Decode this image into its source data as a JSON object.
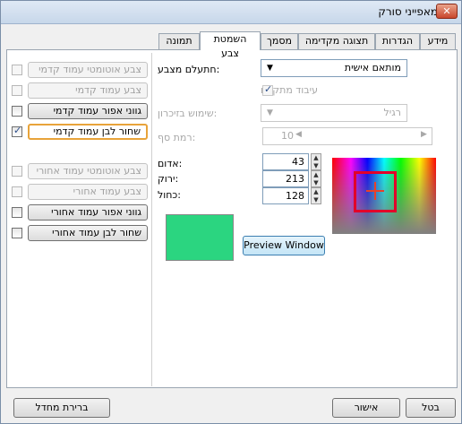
{
  "window": {
    "title": "מאפייני סורק",
    "close_label": "✕"
  },
  "tabs": [
    "מידע",
    "הגדרות",
    "תצוגה מקדימה",
    "מסמך",
    "השמטת צבע",
    "תמונה"
  ],
  "active_tab": "השמטת צבע",
  "options": [
    {
      "label": "צבע אוטומטי עמוד קדמי",
      "enabled": false,
      "checked": false,
      "selected": false
    },
    {
      "label": "צבע עמוד קדמי",
      "enabled": false,
      "checked": false,
      "selected": false
    },
    {
      "label": "גווני אפור עמוד קדמי",
      "enabled": true,
      "checked": false,
      "selected": false
    },
    {
      "label": "שחור לבן עמוד קדמי",
      "enabled": true,
      "checked": true,
      "selected": true
    },
    {
      "label": "צבע אוטומטי עמוד אחורי",
      "enabled": false,
      "checked": false,
      "selected": false
    },
    {
      "label": "צבע עמוד אחורי",
      "enabled": false,
      "checked": false,
      "selected": false
    },
    {
      "label": "גווני אפור עמוד אחורי",
      "enabled": true,
      "checked": false,
      "selected": false
    },
    {
      "label": "שחור לבן עמוד אחורי",
      "enabled": true,
      "checked": false,
      "selected": false
    }
  ],
  "settings": {
    "color_drop_label": ":חתעלם מצבע",
    "color_drop_value": "מותאם אישית",
    "enhance_label": "עיבוד מתקדם",
    "memory_label": ":שימוש בזיכרון",
    "memory_value": "רגיל",
    "threshold_label": ":רמת סף",
    "threshold_value": "10"
  },
  "rgb": {
    "red_label": ":אדום",
    "red_value": "43",
    "green_label": ":ירוק",
    "green_value": "213",
    "blue_label": ":כחול",
    "blue_value": "128"
  },
  "preview_button": "Preview Window",
  "footer": {
    "reset": "ברירת מחדל",
    "ok": "אישור",
    "cancel": "בטל"
  },
  "colors": {
    "swatch": "#2BD580",
    "selected_border": "#e8a33a",
    "picker_marker": "#e2002a"
  }
}
